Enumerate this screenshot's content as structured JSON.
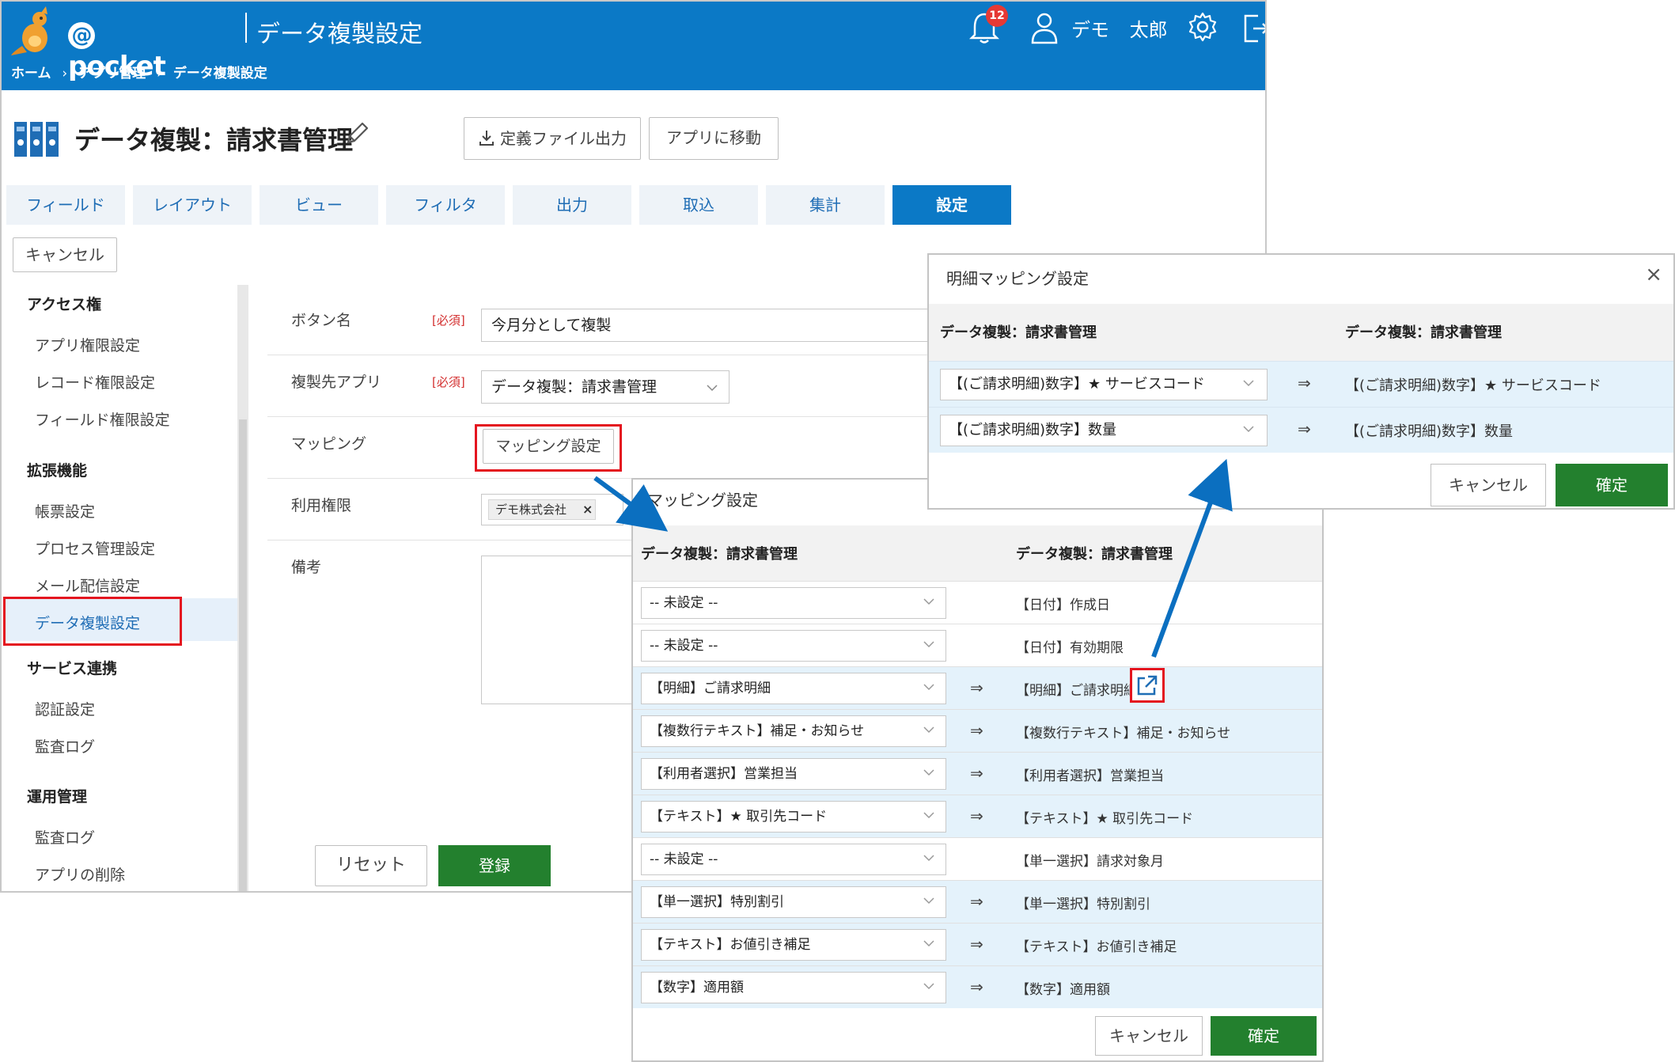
{
  "header": {
    "brand": "pocket",
    "brand_at": "@",
    "page_title": "データ複製設定",
    "breadcrumb": [
      "ホーム",
      "アプリ管理",
      "データ複製設定"
    ],
    "breadcrumb_sep": "›",
    "notification_count": "12",
    "user_name": "デモ 太郎",
    "color": "#0b79c6"
  },
  "title_bar": {
    "app_title": "データ複製：請求書管理",
    "export_label": "定義ファイル出力",
    "goto_app_label": "アプリに移動"
  },
  "tabs": [
    {
      "label": "フィールド",
      "active": false
    },
    {
      "label": "レイアウト",
      "active": false
    },
    {
      "label": "ビュー",
      "active": false
    },
    {
      "label": "フィルタ",
      "active": false
    },
    {
      "label": "出力",
      "active": false
    },
    {
      "label": "取込",
      "active": false
    },
    {
      "label": "集計",
      "active": false
    },
    {
      "label": "設定",
      "active": true
    }
  ],
  "cancel_label": "キャンセル",
  "sidebar": {
    "sections": [
      {
        "title": "アクセス権",
        "items": [
          "アプリ権限設定",
          "レコード権限設定",
          "フィールド権限設定"
        ]
      },
      {
        "title": "拡張機能",
        "items": [
          "帳票設定",
          "プロセス管理設定",
          "メール配信設定",
          "データ複製設定"
        ]
      },
      {
        "title": "サービス連携",
        "items": [
          "認証設定",
          "監査ログ"
        ]
      },
      {
        "title": "運用管理",
        "items": [
          "監査ログ",
          "アプリの削除"
        ]
      }
    ],
    "active_item": "データ複製設定"
  },
  "form": {
    "required_label": "[必須]",
    "button_name_label": "ボタン名",
    "button_name_value": "今月分として複製",
    "target_app_label": "複製先アプリ",
    "target_app_value": "データ複製：請求書管理",
    "mapping_label": "マッピング",
    "mapping_button": "マッピング設定",
    "permission_label": "利用権限",
    "permission_chip": "デモ株式会社",
    "chip_remove": "×",
    "remarks_label": "備考",
    "reset_label": "リセット",
    "register_label": "登録"
  },
  "mapping_dialog": {
    "title": "マッピング設定",
    "col_source": "データ複製：請求書管理",
    "col_dest": "データ複製：請求書管理",
    "arrow": "⇒",
    "rows": [
      {
        "source": "-- 未設定 --",
        "dest": "【日付】作成日",
        "mapped": false
      },
      {
        "source": "-- 未設定 --",
        "dest": "【日付】有効期限",
        "mapped": false
      },
      {
        "source": "【明細】ご請求明細",
        "dest": "【明細】ご請求明細",
        "mapped": true
      },
      {
        "source": "【複数行テキスト】補足・お知らせ",
        "dest": "【複数行テキスト】補足・お知らせ",
        "mapped": true
      },
      {
        "source": "【利用者選択】営業担当",
        "dest": "【利用者選択】営業担当",
        "mapped": true
      },
      {
        "source": "【テキスト】★ 取引先コード",
        "dest": "【テキスト】★ 取引先コード",
        "mapped": true
      },
      {
        "source": "-- 未設定 --",
        "dest": "【単一選択】請求対象月",
        "mapped": false
      },
      {
        "source": "【単一選択】特別割引",
        "dest": "【単一選択】特別割引",
        "mapped": true
      },
      {
        "source": "【テキスト】お値引き補足",
        "dest": "【テキスト】お値引き補足",
        "mapped": true
      },
      {
        "source": "【数字】適用額",
        "dest": "【数字】適用額",
        "mapped": true
      }
    ],
    "cancel_label": "キャンセル",
    "confirm_label": "確定"
  },
  "detail_dialog": {
    "title": "明細マッピング設定",
    "close": "×",
    "col_source": "データ複製：請求書管理",
    "col_dest": "データ複製：請求書管理",
    "arrow": "⇒",
    "rows": [
      {
        "source": "【(ご請求明細)数字】★ サービスコード",
        "dest": "【(ご請求明細)数字】★ サービスコード"
      },
      {
        "source": "【(ご請求明細)数字】数量",
        "dest": "【(ご請求明細)数字】数量"
      }
    ],
    "cancel_label": "キャンセル",
    "confirm_label": "確定"
  },
  "colors": {
    "primary": "#0b79c6",
    "green": "#23802e",
    "highlight_red": "#e4151f",
    "row_highlight": "#e4f2fb"
  }
}
